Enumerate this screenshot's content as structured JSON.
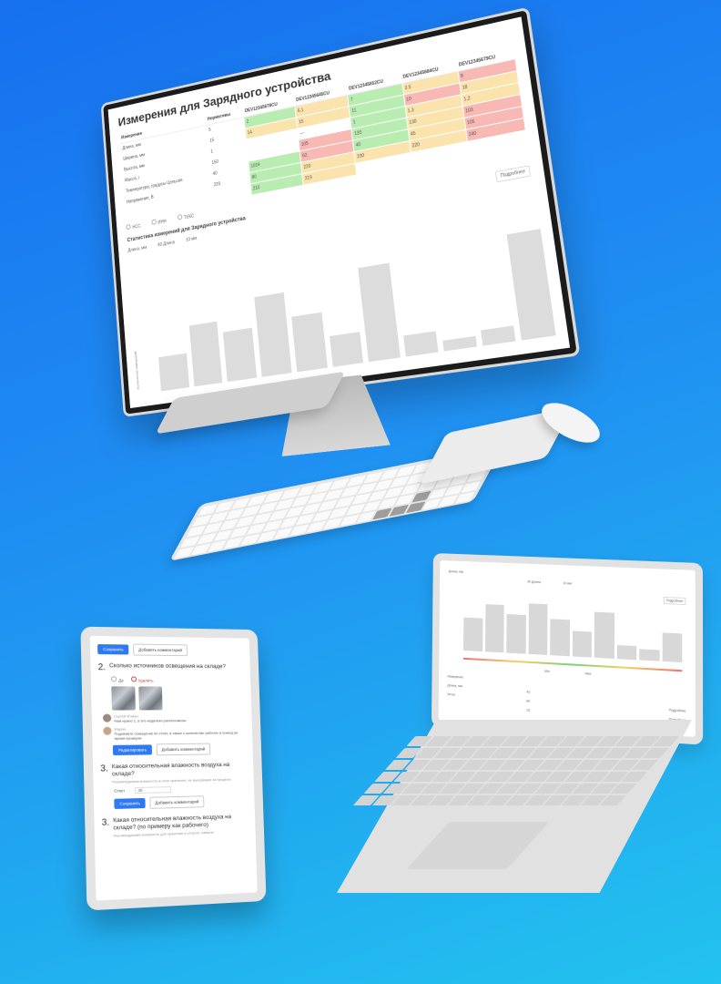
{
  "desktop": {
    "title": "Измерения для Зарядного устройства",
    "table": {
      "header": [
        "Измерения",
        "Нормативы",
        "DEV12345678CU",
        "DEV12345645CU",
        "DEV12345652CU",
        "DEV12345684CU",
        "DEV12345679CU"
      ],
      "rows": [
        {
          "label": "Длина, мм",
          "norm": "5",
          "cells": [
            [
              "2",
              "g"
            ],
            [
              "6.1",
              "y"
            ],
            [
              "7",
              "g"
            ],
            [
              "3.5",
              "y"
            ],
            [
              "8",
              "r"
            ]
          ]
        },
        {
          "label": "Ширина, мм",
          "norm": "15",
          "cells": [
            [
              "14",
              "y"
            ],
            [
              "15",
              "y"
            ],
            [
              "11",
              "g"
            ],
            [
              "10",
              "r"
            ],
            [
              "18",
              "y"
            ]
          ]
        },
        {
          "label": "Высота, мм",
          "norm": "1",
          "cells": [
            [
              "",
              "w"
            ],
            [
              "—",
              "w"
            ],
            [
              "1",
              "g"
            ],
            [
              "1.3",
              "y"
            ],
            [
              "1.2",
              "y"
            ]
          ]
        },
        {
          "label": "Масса, г",
          "norm": "150",
          "cells": [
            [
              "",
              "w"
            ],
            [
              "105",
              "r"
            ],
            [
              "120",
              "g"
            ],
            [
              "130",
              "y"
            ],
            [
              "103",
              "r"
            ]
          ]
        },
        {
          "label": "Температура, градусы Цельсия",
          "norm": "40",
          "cells": [
            [
              "1024",
              "g"
            ],
            [
              "62",
              "r"
            ],
            [
              "40",
              "g"
            ],
            [
              "45",
              "y"
            ],
            [
              "105",
              "r"
            ]
          ]
        },
        {
          "label": "Напряжение, В",
          "norm": "220",
          "cells": [
            [
              "80",
              "g"
            ],
            [
              "220",
              "y"
            ],
            [
              "230",
              "y"
            ],
            [
              "220",
              "y"
            ],
            [
              "240",
              "r"
            ]
          ]
        },
        {
          "label": "",
          "norm": "",
          "cells": [
            [
              "210",
              "g"
            ],
            [
              "219",
              "y"
            ],
            [
              "",
              "w"
            ],
            [
              "",
              "w"
            ],
            [
              "",
              "w"
            ]
          ]
        }
      ]
    },
    "options": [
      "НСС",
      "ИНН",
      "ТЕКС"
    ],
    "details_button": "Подробнее",
    "stats_title": "Статистика измерений для Зарядного устройства",
    "legend": [
      "40 Длина",
      "10 мм"
    ],
    "series_label": "Длина, мм",
    "y_axis_label": "Количество измерений",
    "bar_levels": [
      0.35,
      0.62,
      0.5,
      0.8,
      0.55,
      0.3,
      0.92,
      0.2,
      0.1,
      0.15,
      1.0
    ]
  },
  "tablet": {
    "primary_button": "Сохранить",
    "secondary_button": "Добавить комментарий",
    "q2": {
      "num": "2.",
      "text": "Сколько источников освещения на складе?"
    },
    "q2_options": [
      "Да",
      "Удалить"
    ],
    "comment1_author": "Сергей Фомин",
    "comment1_text": "Нам нужно 1, а это недалеко расположены",
    "comment2_author": "Мария",
    "comment2_text": "Поднимите освещение не стоит, а также о количестве рабочих в помещ во время проверки",
    "edit_button": "Редактировать",
    "add_comment_button": "Добавить комментарий",
    "q3": {
      "num": "3.",
      "text": "Какая относительная влажность воздуха на складе?"
    },
    "q3_hint": "Рекомендуемая влажность в зоне хранения, не выходящая за пределы",
    "q3_value_label": "Ответ",
    "q3_value": "40",
    "q3_save": "Сохранить",
    "q3_add": "Добавить комментарий",
    "q4": {
      "num": "3.",
      "text": "Какая относительная влажность воздуха на складе? (по примеру как рабочего)"
    },
    "q4_hint": "Рекомендуемая влажность для хранения и отпуска товаров"
  },
  "laptop": {
    "series_label": "Длина, мм",
    "legend": [
      "40 Длина",
      "10 мм"
    ],
    "details_button": "Подробнее",
    "bar_levels": [
      0.6,
      0.85,
      0.7,
      0.9,
      0.65,
      0.45,
      0.8,
      0.25,
      0.2,
      0.5
    ],
    "range_labels": [
      "Min",
      "Max"
    ],
    "list_labels": [
      "Измерение",
      "Длина, мм",
      "Итого"
    ],
    "list_values": [
      "40",
      "80",
      "15"
    ],
    "side_buttons": [
      "Подробнее",
      "Подробнее",
      "Подробнее"
    ]
  }
}
